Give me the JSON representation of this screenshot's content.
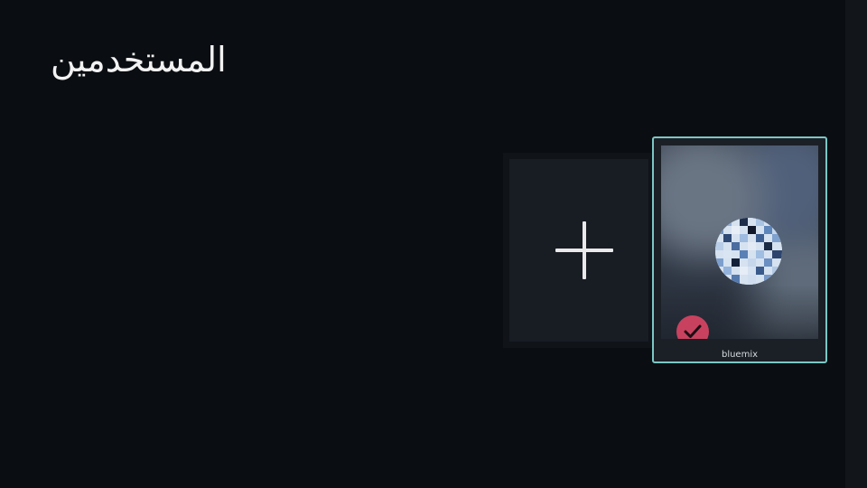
{
  "header": {
    "title": "المستخدمين"
  },
  "add_user": {
    "icon": "plus-icon"
  },
  "profiles": [
    {
      "name": "bluemix",
      "selected": true,
      "badge_icon": "checkmark-icon",
      "badge_color": "#c8425f",
      "border_color": "#7cc7c4"
    }
  ],
  "colors": {
    "background": "#0a0d11",
    "card": "#181c23",
    "text": "#f2f2f2"
  }
}
